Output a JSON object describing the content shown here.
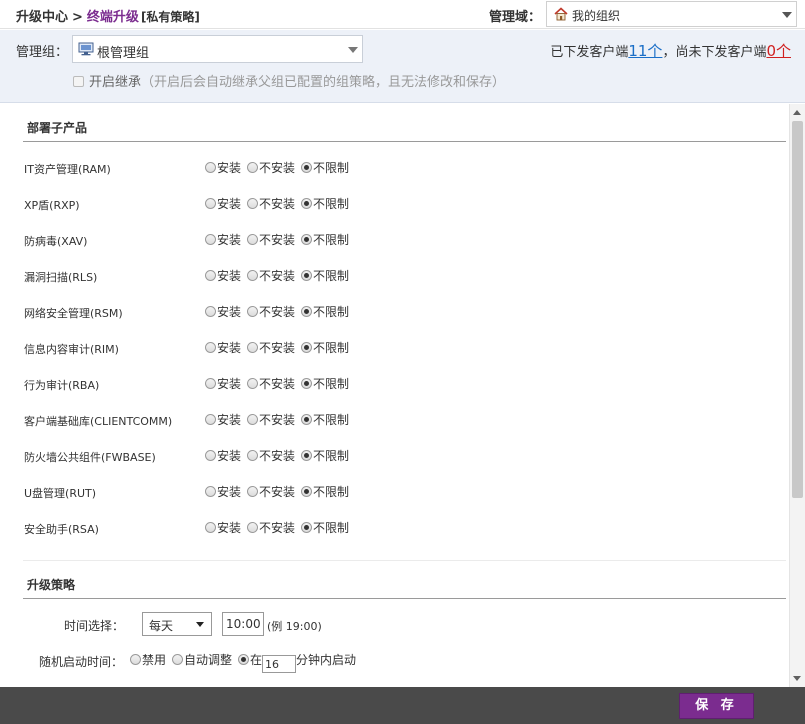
{
  "breadcrumb": {
    "root": "升级中心",
    "separator": ">",
    "current": "终端升级",
    "sub": "[私有策略]"
  },
  "domain": {
    "label": "管理域：",
    "value": "我的组织"
  },
  "group": {
    "label": "管理组：",
    "value": "根管理组",
    "issued_prefix": "已下发客户端",
    "issued_count": "11个",
    "not_issued_prefix": "，尚未下发客户端",
    "not_issued_count": "0个",
    "inherit_label": "开启继承",
    "inherit_hint": "（开启后会自动继承父组已配置的组策略，且无法修改和保存）"
  },
  "products": {
    "title": "部署子产品",
    "option_labels": [
      "安装",
      "不安装",
      "不限制"
    ],
    "items": [
      {
        "name": "IT资产管理(RAM)",
        "selected": 2
      },
      {
        "name": "XP盾(RXP)",
        "selected": 2
      },
      {
        "name": "防病毒(XAV)",
        "selected": 2
      },
      {
        "name": "漏洞扫描(RLS)",
        "selected": 2
      },
      {
        "name": "网络安全管理(RSM)",
        "selected": 2
      },
      {
        "name": "信息内容审计(RIM)",
        "selected": 2
      },
      {
        "name": "行为审计(RBA)",
        "selected": 2
      },
      {
        "name": "客户端基础库(CLIENTCOMM)",
        "selected": 2
      },
      {
        "name": "防火墙公共组件(FWBASE)",
        "selected": 2
      },
      {
        "name": "U盘管理(RUT)",
        "selected": 2
      },
      {
        "name": "安全助手(RSA)",
        "selected": 2
      }
    ]
  },
  "strategy": {
    "title": "升级策略",
    "time_label": "时间选择：",
    "frequency": "每天",
    "time_value": "10:00",
    "time_hint": "(例 19:00)",
    "random_label": "随机启动时间：",
    "random_options": [
      "禁用",
      "自动调整",
      "在"
    ],
    "random_selected": 2,
    "minutes": "16",
    "minutes_suffix": "分钟内启动"
  },
  "footer": {
    "save_label": "保 存"
  },
  "colors": {
    "accent": "#7b2c8f",
    "link_blue": "#1a6ec7",
    "link_red": "#d02020",
    "footer_bg": "#4a4a4a",
    "group_panel_bg": "#edf1f8"
  }
}
